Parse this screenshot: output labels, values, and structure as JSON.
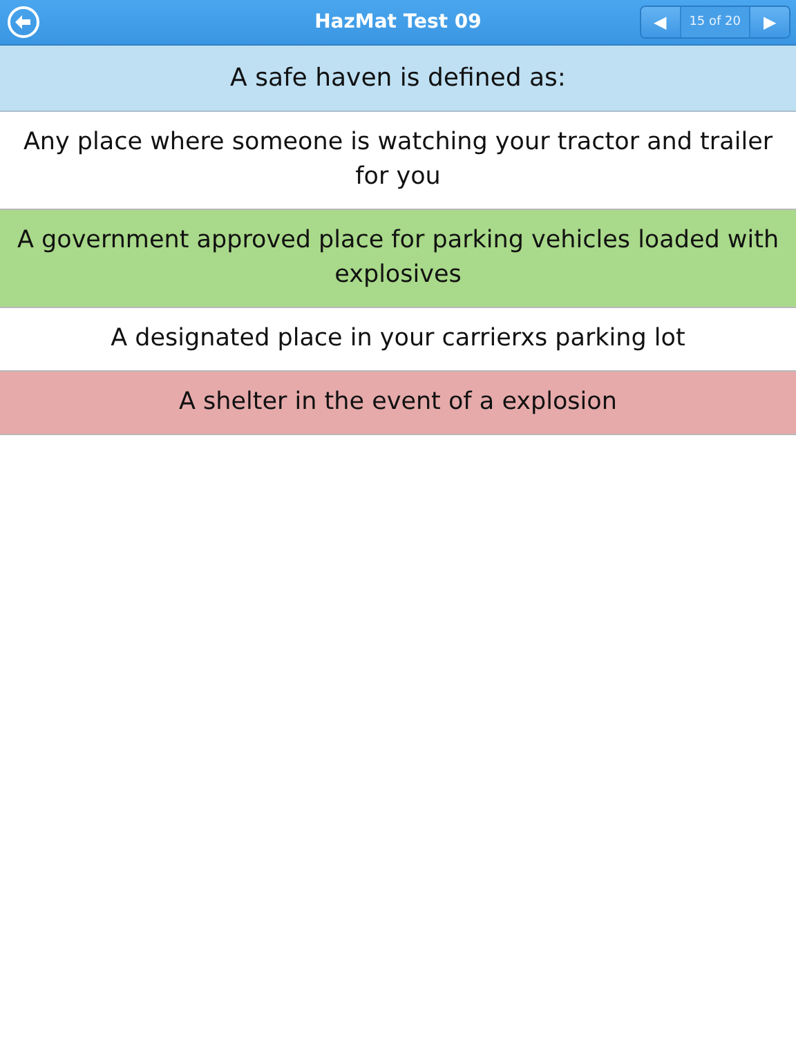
{
  "header": {
    "title": "HazMat Test 09",
    "prev": "◀",
    "counter": "15 of 20",
    "next": "▶"
  },
  "question": "A safe haven is defined as:",
  "answers": [
    {
      "text": "Any place where someone is watching your tractor and trailer for you",
      "correct": false,
      "selected": false
    },
    {
      "text": "A government approved place for parking vehicles loaded with explosives",
      "correct": true,
      "selected": false
    },
    {
      "text": "A designated place in your carrierxs parking lot",
      "correct": false,
      "selected": false
    },
    {
      "text": "A shelter in the event of a explosion",
      "correct": false,
      "selected": true
    }
  ]
}
